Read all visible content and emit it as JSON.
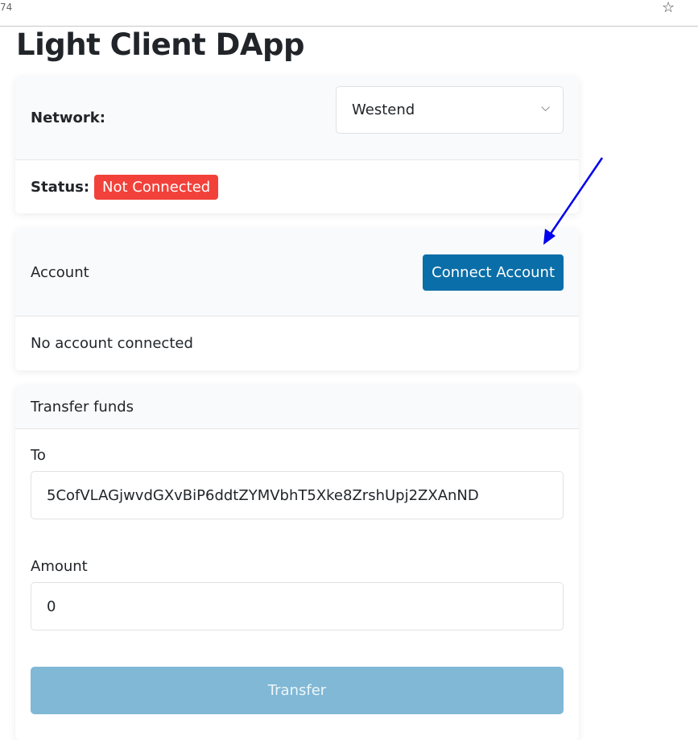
{
  "browser": {
    "url_fragment": "74",
    "star_icon": "star-icon"
  },
  "title": "Light Client DApp",
  "network": {
    "label": "Network:",
    "selected": "Westend"
  },
  "status": {
    "label": "Status:",
    "value": "Not Connected",
    "color": "#f2413a"
  },
  "account": {
    "label": "Account",
    "connect_button": "Connect Account",
    "message": "No account connected",
    "accent": "#0a6ea8"
  },
  "transfer": {
    "header": "Transfer funds",
    "to_label": "To",
    "to_value": "5CofVLAGjwvdGXvBiP6ddtZYMVbhT5Xke8ZrshUpj2ZXAnND",
    "amount_label": "Amount",
    "amount_value": "0",
    "button": "Transfer"
  },
  "annotation": {
    "arrow_color": "#0000ee"
  }
}
